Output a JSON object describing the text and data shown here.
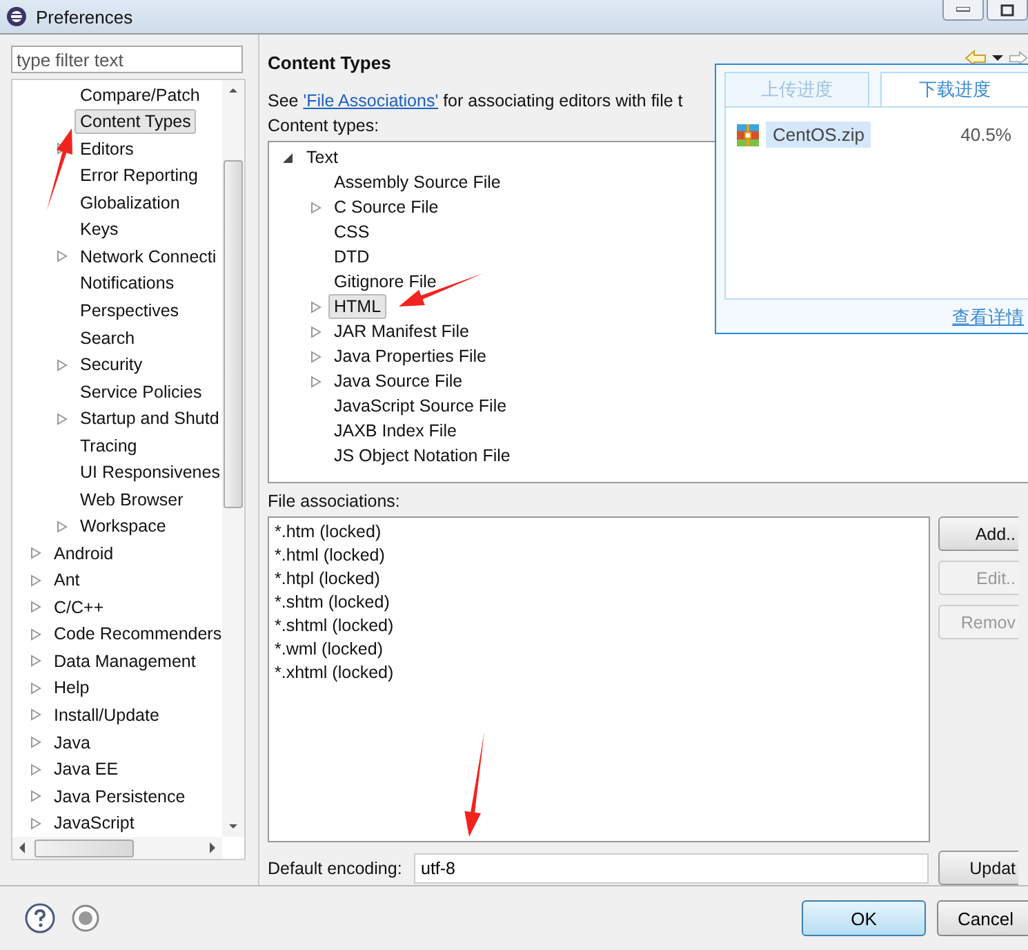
{
  "window": {
    "title": "Preferences"
  },
  "filter": {
    "placeholder": "type filter text"
  },
  "tree": {
    "continued_children": [
      {
        "label": "Compare/Patch",
        "expandable": false,
        "selected": false
      },
      {
        "label": "Content Types",
        "expandable": false,
        "selected": true
      },
      {
        "label": "Editors",
        "expandable": true,
        "selected": false
      },
      {
        "label": "Error Reporting",
        "expandable": false,
        "selected": false
      },
      {
        "label": "Globalization",
        "expandable": false,
        "selected": false
      },
      {
        "label": "Keys",
        "expandable": false,
        "selected": false
      },
      {
        "label": "Network Connecti",
        "expandable": true,
        "selected": false
      },
      {
        "label": "Notifications",
        "expandable": false,
        "selected": false
      },
      {
        "label": "Perspectives",
        "expandable": false,
        "selected": false
      },
      {
        "label": "Search",
        "expandable": false,
        "selected": false
      },
      {
        "label": "Security",
        "expandable": true,
        "selected": false
      },
      {
        "label": "Service Policies",
        "expandable": false,
        "selected": false
      },
      {
        "label": "Startup and Shutd",
        "expandable": true,
        "selected": false
      },
      {
        "label": "Tracing",
        "expandable": false,
        "selected": false
      },
      {
        "label": "UI Responsivenes",
        "expandable": false,
        "selected": false
      },
      {
        "label": "Web Browser",
        "expandable": false,
        "selected": false
      },
      {
        "label": "Workspace",
        "expandable": true,
        "selected": false
      }
    ],
    "items": [
      {
        "label": "Android",
        "expandable": true,
        "selected": false
      },
      {
        "label": "Ant",
        "expandable": true,
        "selected": false
      },
      {
        "label": "C/C++",
        "expandable": true,
        "selected": false
      },
      {
        "label": "Code Recommenders",
        "expandable": true,
        "selected": false
      },
      {
        "label": "Data Management",
        "expandable": true,
        "selected": false
      },
      {
        "label": "Help",
        "expandable": true,
        "selected": false
      },
      {
        "label": "Install/Update",
        "expandable": true,
        "selected": false
      },
      {
        "label": "Java",
        "expandable": true,
        "selected": false
      },
      {
        "label": "Java EE",
        "expandable": true,
        "selected": false
      },
      {
        "label": "Java Persistence",
        "expandable": true,
        "selected": false
      },
      {
        "label": "JavaScript",
        "expandable": true,
        "selected": false
      }
    ]
  },
  "page": {
    "title": "Content Types",
    "intro": {
      "before": "See ",
      "link": "'File Associations'",
      "after": " for associating editors with file t"
    },
    "content_types_label": "Content types:",
    "content_types": [
      {
        "label": "Text",
        "expandable": true,
        "expanded": true,
        "selected": false,
        "children": [
          {
            "label": "Assembly Source File",
            "expandable": false,
            "selected": false
          },
          {
            "label": "C Source File",
            "expandable": true,
            "selected": false
          },
          {
            "label": "CSS",
            "expandable": false,
            "selected": false
          },
          {
            "label": "DTD",
            "expandable": false,
            "selected": false
          },
          {
            "label": "Gitignore File",
            "expandable": false,
            "selected": false
          },
          {
            "label": "HTML",
            "expandable": true,
            "selected": true
          },
          {
            "label": "JAR Manifest File",
            "expandable": true,
            "selected": false
          },
          {
            "label": "Java Properties File",
            "expandable": true,
            "selected": false
          },
          {
            "label": "Java Source File",
            "expandable": true,
            "selected": false
          },
          {
            "label": "JavaScript Source File",
            "expandable": false,
            "selected": false
          },
          {
            "label": "JAXB Index File",
            "expandable": false,
            "selected": false
          },
          {
            "label": "JS Object Notation File",
            "expandable": false,
            "selected": false
          }
        ]
      }
    ],
    "file_associations_label": "File associations:",
    "file_associations": [
      "*.htm (locked)",
      "*.html (locked)",
      "*.htpl (locked)",
      "*.shtm (locked)",
      "*.shtml (locked)",
      "*.wml (locked)",
      "*.xhtml (locked)"
    ],
    "side_buttons": [
      {
        "label": "Add..",
        "disabled": false
      },
      {
        "label": "Edit..",
        "disabled": true
      },
      {
        "label": "Remov",
        "disabled": true
      }
    ],
    "encoding_label": "Default encoding:",
    "encoding_value": "utf-8",
    "update_button": "Updat"
  },
  "footer": {
    "buttons": [
      {
        "label": "OK",
        "default": true
      },
      {
        "label": "Cancel",
        "default": false
      }
    ]
  },
  "download_popup": {
    "tabs": [
      {
        "label": "上传进度",
        "selected": false
      },
      {
        "label": "下载进度",
        "selected": true
      }
    ],
    "items": [
      {
        "name": "CentOS.zip",
        "progress": "40.5%"
      }
    ],
    "details_link": "查看详情"
  }
}
